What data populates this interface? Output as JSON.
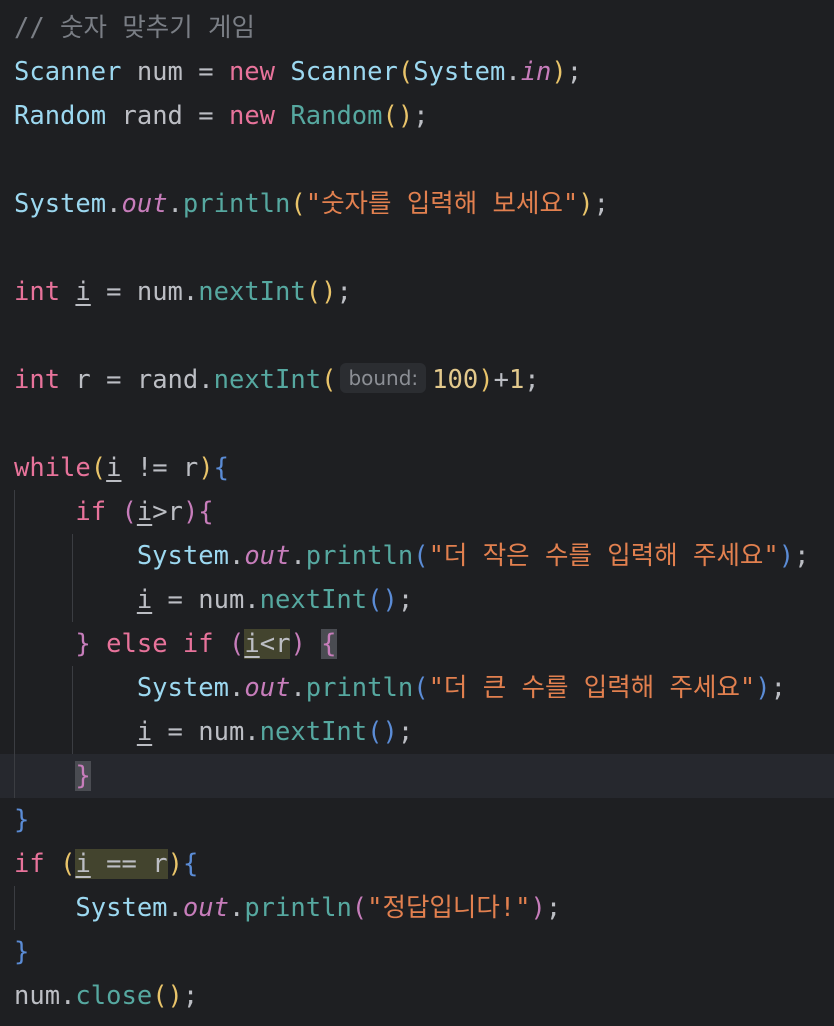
{
  "editor": {
    "comment": "// 숫자 맞추기 게임",
    "line_scanner": {
      "type": "Scanner",
      "var": "num",
      "eq": " = ",
      "kw_new": "new",
      "ctor": "Scanner",
      "arg_class": "System",
      "dot": ".",
      "arg_field": "in",
      "end": ";"
    },
    "line_random": {
      "type": "Random",
      "var": "rand",
      "eq": " = ",
      "kw_new": "new",
      "ctor": "Random",
      "end": ";"
    },
    "line_print1": {
      "cls": "System",
      "field": "out",
      "method": "println",
      "string": "\"숫자를 입력해 보세요\"",
      "end": ";"
    },
    "line_int_i": {
      "kw": "int",
      "var": "i",
      "rest": " = num.",
      "method": "nextInt",
      "end": ";"
    },
    "line_int_r": {
      "kw": "int",
      "var": "r",
      "rest": " = rand.",
      "method": "nextInt",
      "hint_label": "bound:",
      "num": "100",
      "plus": "+",
      "num2": "1",
      "end": ";"
    },
    "line_while": {
      "kw": "while",
      "var_i": "i",
      "op": " != ",
      "var_r": "r"
    },
    "line_if1": {
      "kw": "if",
      "var_i": "i",
      "op": ">",
      "var_r": "r"
    },
    "line_print_small": {
      "cls": "System",
      "field": "out",
      "method": "println",
      "string": "\"더 작은 수를 입력해 주세요\"",
      "end": ";"
    },
    "line_assign1": {
      "var": "i",
      "rest": " = num.",
      "method": "nextInt",
      "end": ";"
    },
    "line_elseif": {
      "kw_else": "else",
      "kw_if": "if",
      "var_i": "i",
      "op": "<",
      "var_r": "r"
    },
    "line_print_big": {
      "cls": "System",
      "field": "out",
      "method": "println",
      "string": "\"더 큰 수를 입력해 주세요\"",
      "end": ";"
    },
    "line_assign2": {
      "var": "i",
      "rest": " = num.",
      "method": "nextInt",
      "end": ";"
    },
    "line_if_eq": {
      "kw": "if",
      "var_i": "i",
      "op": " == ",
      "var_r": "r"
    },
    "line_print_correct": {
      "cls": "System",
      "field": "out",
      "method": "println",
      "string": "\"정답입니다!\"",
      "end": ";"
    },
    "line_close": {
      "var": "num",
      "dot": ".",
      "method": "close",
      "end": ";"
    }
  },
  "colors": {
    "background": "#1e1f22",
    "keyword": "#e8739b",
    "class": "#9cd8f0",
    "method": "#56a8a0",
    "string": "#e2804f",
    "comment": "#7a7e85"
  }
}
